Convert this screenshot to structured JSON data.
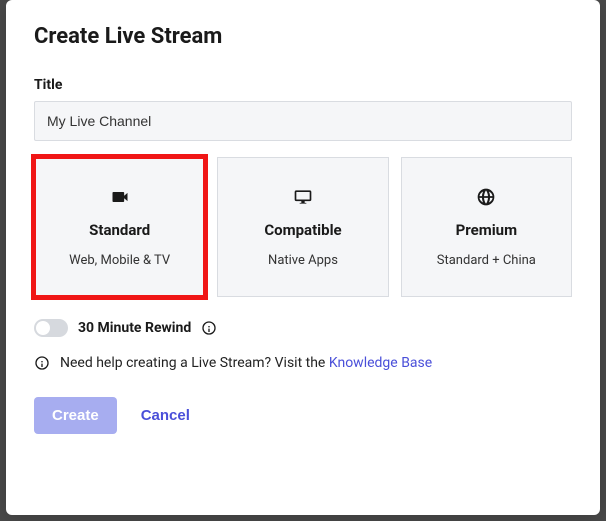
{
  "dialog": {
    "title": "Create Live Stream",
    "title_field_label": "Title",
    "title_value": "My Live Channel"
  },
  "options": [
    {
      "key": "standard",
      "icon": "video-camera-icon",
      "label": "Standard",
      "sub": "Web, Mobile & TV",
      "selected": true
    },
    {
      "key": "compatible",
      "icon": "monitor-icon",
      "label": "Compatible",
      "sub": "Native Apps",
      "selected": false
    },
    {
      "key": "premium",
      "icon": "globe-icon",
      "label": "Premium",
      "sub": "Standard + China",
      "selected": false
    }
  ],
  "toggle": {
    "label": "30 Minute Rewind",
    "on": false
  },
  "help": {
    "prefix": "Need help creating a Live Stream? Visit the ",
    "link_text": "Knowledge Base"
  },
  "actions": {
    "create": "Create",
    "cancel": "Cancel"
  }
}
